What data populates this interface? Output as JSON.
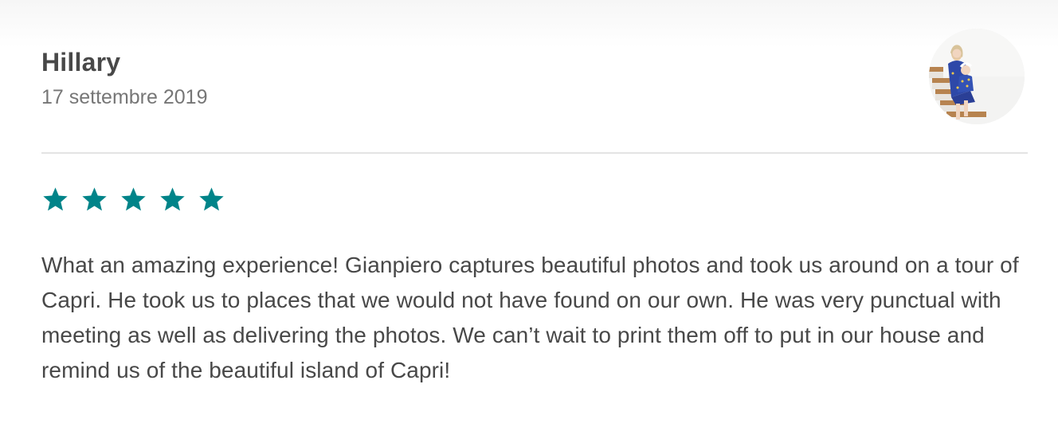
{
  "review": {
    "reviewer_name": "Hillary",
    "date": "17 settembre 2019",
    "rating": 5,
    "max_rating": 5,
    "star_color": "#008489",
    "text": "What an amazing experience! Gianpiero captures beautiful photos and took us around on a tour of Capri. He took us to places that we would not have found on our own. He was very punctual with meeting as well as delivering the photos. We can’t wait to print them off to put in our house and remind us of the beautiful island of Capri!"
  }
}
